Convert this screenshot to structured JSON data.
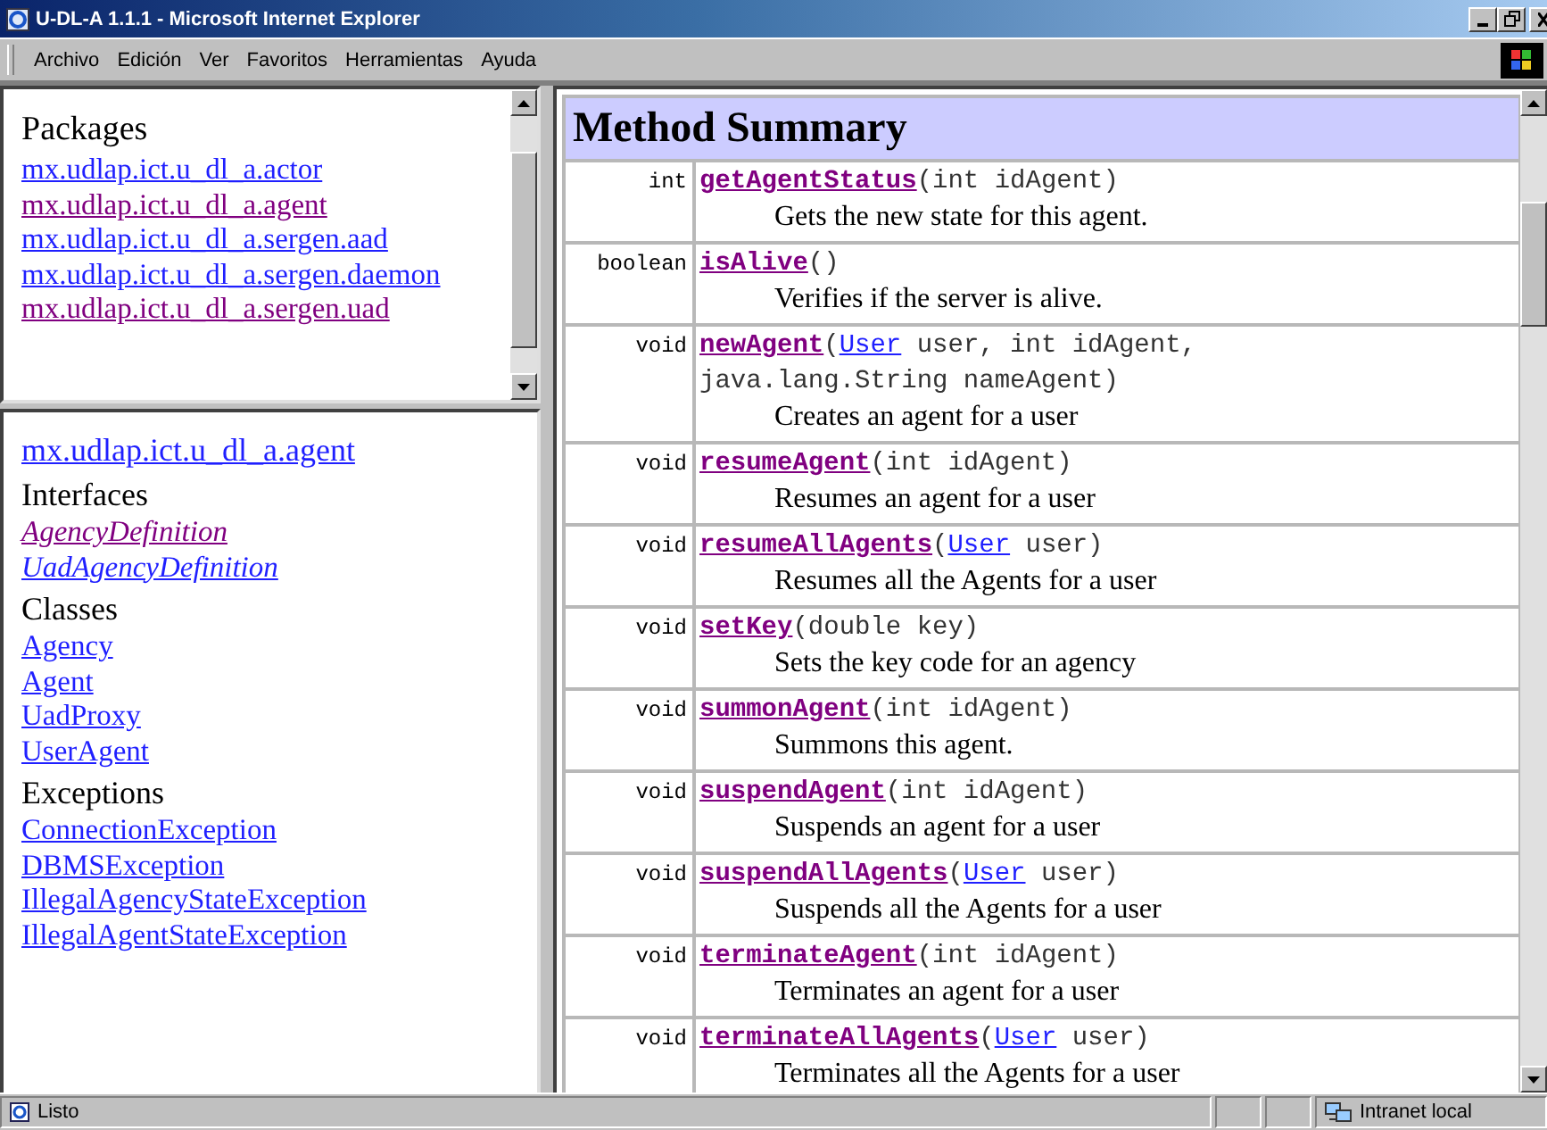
{
  "window": {
    "title": "U-DL-A 1.1.1 - Microsoft Internet Explorer"
  },
  "menu": [
    "Archivo",
    "Edición",
    "Ver",
    "Favoritos",
    "Herramientas",
    "Ayuda"
  ],
  "packages_frame": {
    "heading": "Packages",
    "links": [
      {
        "text": "mx.udlap.ict.u_dl_a.actor",
        "visited": false
      },
      {
        "text": "mx.udlap.ict.u_dl_a.agent",
        "visited": true
      },
      {
        "text": "mx.udlap.ict.u_dl_a.sergen.aad",
        "visited": false
      },
      {
        "text": "mx.udlap.ict.u_dl_a.sergen.daemon",
        "visited": false
      },
      {
        "text": "mx.udlap.ict.u_dl_a.sergen.uad",
        "visited": true
      }
    ]
  },
  "package_frame": {
    "package_link": {
      "text": "mx.udlap.ict.u_dl_a.agent",
      "visited": false
    },
    "sections": [
      {
        "heading": "Interfaces",
        "italic": true,
        "links": [
          {
            "text": "AgencyDefinition",
            "visited": true
          },
          {
            "text": "UadAgencyDefinition",
            "visited": false
          }
        ]
      },
      {
        "heading": "Classes",
        "italic": false,
        "links": [
          {
            "text": "Agency",
            "visited": false
          },
          {
            "text": "Agent",
            "visited": false
          },
          {
            "text": "UadProxy",
            "visited": false
          },
          {
            "text": "UserAgent",
            "visited": false
          }
        ]
      },
      {
        "heading": "Exceptions",
        "italic": false,
        "links": [
          {
            "text": "ConnectionException",
            "visited": false
          },
          {
            "text": "DBMSException",
            "visited": false
          },
          {
            "text": "IllegalAgencyStateException",
            "visited": false
          },
          {
            "text": "IllegalAgentStateException",
            "visited": false
          }
        ]
      }
    ]
  },
  "method_summary": {
    "heading": "Method Summary",
    "rows": [
      {
        "type": "int",
        "lines": [
          [
            {
              "kind": "method",
              "text": "getAgentStatus",
              "visited": true
            },
            {
              "kind": "code",
              "text": "(int idAgent)"
            }
          ]
        ],
        "description": "Gets the new state for this agent."
      },
      {
        "type": "boolean",
        "lines": [
          [
            {
              "kind": "method",
              "text": "isAlive",
              "visited": true
            },
            {
              "kind": "code",
              "text": "()"
            }
          ]
        ],
        "description": "Verifies if the server is alive."
      },
      {
        "type": "void",
        "lines": [
          [
            {
              "kind": "method",
              "text": "newAgent",
              "visited": true
            },
            {
              "kind": "code",
              "text": "("
            },
            {
              "kind": "link",
              "text": "User",
              "visited": false
            },
            {
              "kind": "code",
              "text": " user, int idAgent,"
            }
          ],
          [
            {
              "kind": "code",
              "text": "java.lang.String nameAgent)"
            }
          ]
        ],
        "description": "Creates an agent for a user"
      },
      {
        "type": "void",
        "lines": [
          [
            {
              "kind": "method",
              "text": "resumeAgent",
              "visited": true
            },
            {
              "kind": "code",
              "text": "(int idAgent)"
            }
          ]
        ],
        "description": "Resumes an agent for a user"
      },
      {
        "type": "void",
        "lines": [
          [
            {
              "kind": "method",
              "text": "resumeAllAgents",
              "visited": true
            },
            {
              "kind": "code",
              "text": "("
            },
            {
              "kind": "link",
              "text": "User",
              "visited": false
            },
            {
              "kind": "code",
              "text": " user)"
            }
          ]
        ],
        "description": "Resumes all the Agents for a user"
      },
      {
        "type": "void",
        "lines": [
          [
            {
              "kind": "method",
              "text": "setKey",
              "visited": true
            },
            {
              "kind": "code",
              "text": "(double key)"
            }
          ]
        ],
        "description": "Sets the key code for an agency"
      },
      {
        "type": "void",
        "lines": [
          [
            {
              "kind": "method",
              "text": "summonAgent",
              "visited": true
            },
            {
              "kind": "code",
              "text": "(int idAgent)"
            }
          ]
        ],
        "description": "Summons this agent."
      },
      {
        "type": "void",
        "lines": [
          [
            {
              "kind": "method",
              "text": "suspendAgent",
              "visited": true
            },
            {
              "kind": "code",
              "text": "(int idAgent)"
            }
          ]
        ],
        "description": "Suspends an agent for a user"
      },
      {
        "type": "void",
        "lines": [
          [
            {
              "kind": "method",
              "text": "suspendAllAgents",
              "visited": true
            },
            {
              "kind": "code",
              "text": "("
            },
            {
              "kind": "link",
              "text": "User",
              "visited": false
            },
            {
              "kind": "code",
              "text": " user)"
            }
          ]
        ],
        "description": "Suspends all the Agents for a user"
      },
      {
        "type": "void",
        "lines": [
          [
            {
              "kind": "method",
              "text": "terminateAgent",
              "visited": true
            },
            {
              "kind": "code",
              "text": "(int idAgent)"
            }
          ]
        ],
        "description": "Terminates an agent for a user"
      },
      {
        "type": "void",
        "lines": [
          [
            {
              "kind": "method",
              "text": "terminateAllAgents",
              "visited": true
            },
            {
              "kind": "code",
              "text": "("
            },
            {
              "kind": "link",
              "text": "User",
              "visited": false
            },
            {
              "kind": "code",
              "text": " user)"
            }
          ]
        ],
        "description": "Terminates all the Agents for a user"
      }
    ]
  },
  "status_bar": {
    "text": "Listo",
    "zone": "Intranet local"
  }
}
